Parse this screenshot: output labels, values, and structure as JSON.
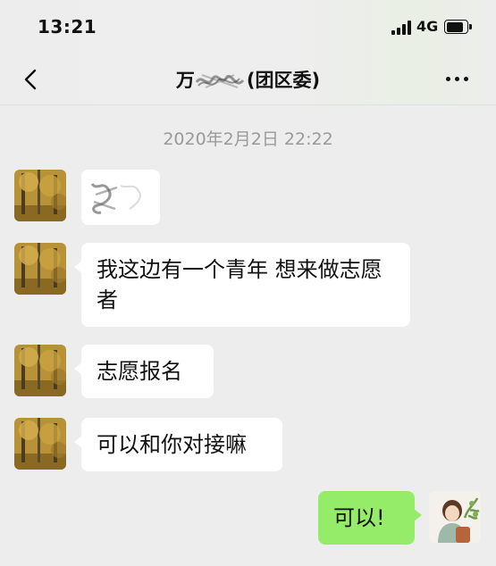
{
  "status_bar": {
    "time": "13:21",
    "network": "4G"
  },
  "nav": {
    "title_prefix": "万",
    "title_suffix": "(团区委)"
  },
  "chat": {
    "timestamp": "2020年2月2日 22:22",
    "messages": [
      {
        "from": "them",
        "type": "image",
        "avatar": "autumn-forest"
      },
      {
        "from": "them",
        "type": "text",
        "text": "我这边有一个青年 想来做志愿者",
        "avatar": "autumn-forest"
      },
      {
        "from": "them",
        "type": "text",
        "text": "志愿报名",
        "avatar": "autumn-forest"
      },
      {
        "from": "them",
        "type": "text",
        "text": "可以和你对接嘛",
        "avatar": "autumn-forest"
      },
      {
        "from": "me",
        "type": "text",
        "text": "可以!",
        "avatar": "girl-with-plant"
      }
    ]
  },
  "colors": {
    "background": "#ededed",
    "bubble_received": "#ffffff",
    "bubble_sent": "#95ec69",
    "timestamp": "#9a9a9a"
  }
}
